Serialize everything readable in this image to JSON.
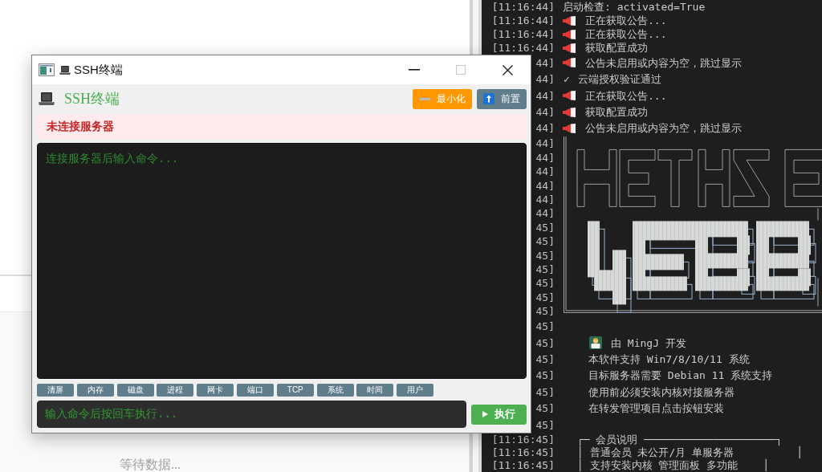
{
  "background_panel": {
    "status_text": "等待数据..."
  },
  "console": {
    "lines": [
      {
        "time": "[11:16:44]",
        "kind": "plain",
        "text": "启动检查: activated=True"
      },
      {
        "time": "[11:16:44]",
        "kind": "notice",
        "text": "正在获取公告..."
      },
      {
        "time": "[11:16:44]",
        "kind": "notice",
        "text": "正在获取公告..."
      },
      {
        "time": "[11:16:44]",
        "kind": "notice",
        "text": "获取配置成功"
      },
      {
        "time": "44]",
        "kind": "notice",
        "text": "公告未启用或内容为空，跳过显示"
      },
      {
        "time": "44]",
        "kind": "check",
        "mark": "✓",
        "text": "云端授权验证通过"
      },
      {
        "time": "44]",
        "kind": "notice",
        "text": "正在获取公告..."
      },
      {
        "time": "44]",
        "kind": "notice",
        "text": "获取配置成功"
      },
      {
        "time": "44]",
        "kind": "notice",
        "text": "公告未启用或内容为空，跳过显示"
      }
    ],
    "banner_times": [
      "44]",
      "44]",
      "44]",
      "44]",
      "44]",
      "44]",
      "45]",
      "45]",
      "45]",
      "45]",
      "45]",
      "45]",
      "45]"
    ],
    "info_lines": [
      {
        "time": "45]",
        "kind": "blank"
      },
      {
        "time": "45]",
        "kind": "developer",
        "text": "由 MingJ 开发"
      },
      {
        "time": "45]",
        "kind": "plain",
        "text": "本软件支持 Win7/8/10/11 系统"
      },
      {
        "time": "45]",
        "kind": "plain",
        "text": "目标服务器需要 Debian 11 系统支持"
      },
      {
        "time": "45]",
        "kind": "plain",
        "text": "使用前必须安装内核对接服务器"
      },
      {
        "time": "45]",
        "kind": "plain",
        "text": "在转发管理项目点击按钮安装"
      },
      {
        "time": "45]",
        "kind": "blank"
      },
      {
        "time": "[11:16:45]",
        "kind": "box",
        "text": "┌─ 会员说明 ─────────────────────┐"
      },
      {
        "time": "[11:16:45]",
        "kind": "box",
        "text": "│ 普通会员 未公开/月 单服务器          │"
      },
      {
        "time": "[11:16:45]",
        "kind": "box",
        "text": "│ 支持安装内核 管理面板 多功能    │"
      }
    ]
  },
  "ssh_window": {
    "title": "SSH终端",
    "controls": [
      {
        "kind": "minimize",
        "disabled": false
      },
      {
        "kind": "maximize",
        "disabled": true
      },
      {
        "kind": "close",
        "disabled": false
      }
    ],
    "header": {
      "title": "SSH终端",
      "buttons": [
        {
          "kind": "minimize",
          "label": "最小化"
        },
        {
          "kind": "pin",
          "label": "前置"
        }
      ]
    },
    "status": {
      "connected": false,
      "text": "未连接服务器"
    },
    "output": {
      "placeholder": "连接服务器后输入命令..."
    },
    "quick_commands": [
      "清屏",
      "内存",
      "磁盘",
      "进程",
      "网卡",
      "端口",
      "TCP",
      "系统",
      "时间",
      "用户"
    ],
    "command_input": {
      "placeholder": "输入命令后按回车执行..."
    },
    "run_button": {
      "label": "执行"
    }
  }
}
